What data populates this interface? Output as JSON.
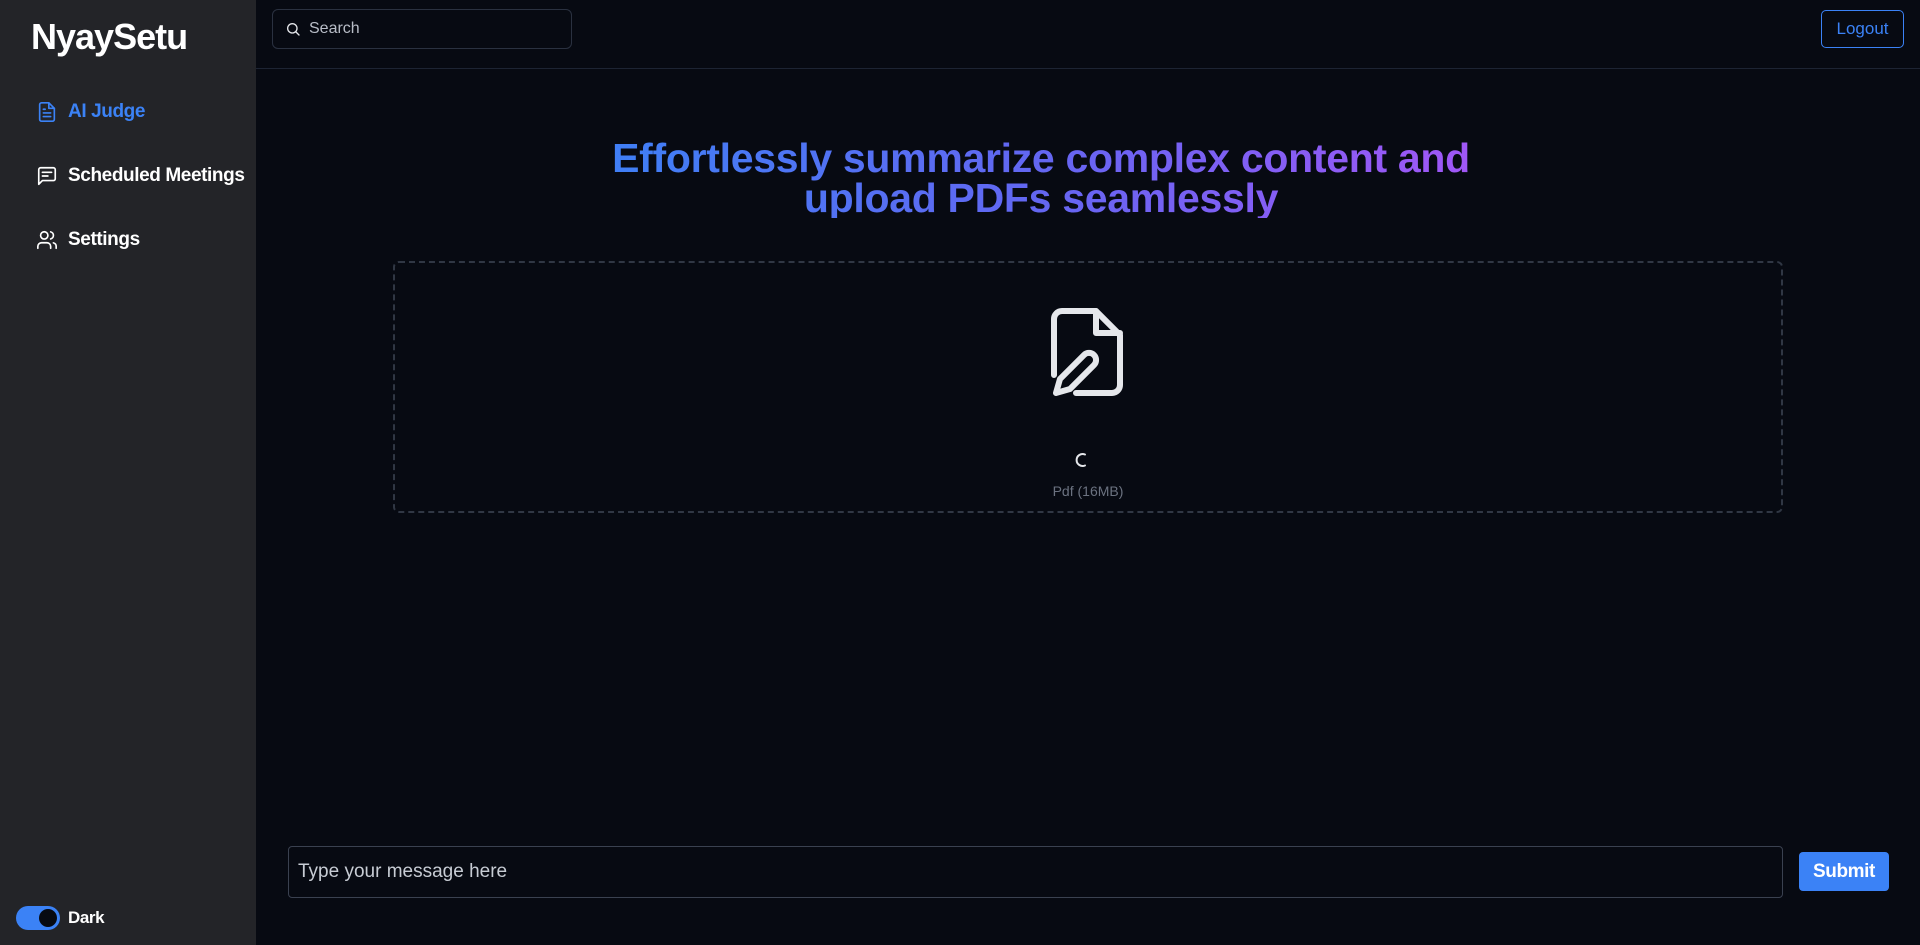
{
  "brand": "NyaySetu",
  "sidebar": {
    "items": [
      {
        "label": "AI Judge",
        "icon": "document-icon",
        "active": true
      },
      {
        "label": "Scheduled Meetings",
        "icon": "message-square-icon",
        "active": false
      },
      {
        "label": "Settings",
        "icon": "users-icon",
        "active": false
      }
    ],
    "theme_toggle": {
      "label": "Dark",
      "on": true
    }
  },
  "topbar": {
    "search": {
      "placeholder": "Search",
      "value": ""
    },
    "logout_label": "Logout"
  },
  "main": {
    "headline": "Effortlessly summarize complex content and upload PDFs seamlessly",
    "dropzone": {
      "hint": "Pdf (16MB)",
      "icon": "file-pen-icon",
      "loading": true
    },
    "composer": {
      "placeholder": "Type your message here",
      "value": ""
    },
    "submit_label": "Submit"
  },
  "colors": {
    "accent": "#3b82f6",
    "background": "#070a12",
    "sidebar": "#232428",
    "gradient_start": "#3b82f6",
    "gradient_end": "#a855f7"
  }
}
